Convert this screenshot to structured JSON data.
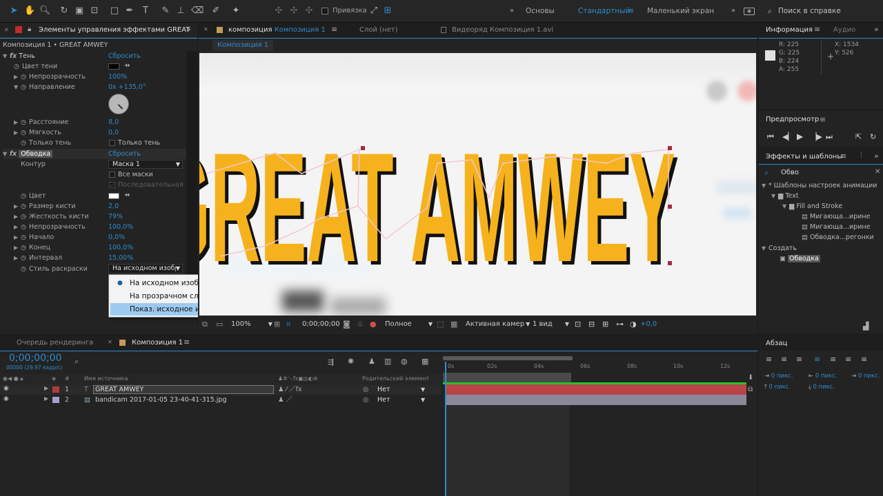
{
  "toolbar": {
    "snapping_label": "Привязка",
    "workspaces": [
      "Основы",
      "Стандартный",
      "Маленький экран"
    ],
    "search_help": "Поиск в справке"
  },
  "effect_controls": {
    "tab_title": "Элементы управления эффектами GREAT",
    "subtitle": "Композиция 1 • GREAT AMWEY",
    "effects": [
      {
        "name": "Тень",
        "reset": "Сбросить",
        "props": [
          {
            "label": "Цвет тени",
            "value": ""
          },
          {
            "label": "Непрозрачность",
            "value": "100%"
          },
          {
            "label": "Направление",
            "value": "0x +135,0°"
          },
          {
            "label": "Расстояние",
            "value": "8,0"
          },
          {
            "label": "Мягкость",
            "value": "0,0"
          },
          {
            "label": "Только тень",
            "value": "Только тень"
          }
        ]
      },
      {
        "name": "Обводка",
        "reset": "Сбросить",
        "props": [
          {
            "label": "Контур",
            "value": "Маска 1"
          },
          {
            "label": "",
            "value": "Все маски"
          },
          {
            "label": "",
            "value": "Последовательная"
          },
          {
            "label": "Цвет",
            "value": ""
          },
          {
            "label": "Размер кисти",
            "value": "2,0"
          },
          {
            "label": "Жесткость кисти",
            "value": "79%"
          },
          {
            "label": "Непрозрачность",
            "value": "100,0%"
          },
          {
            "label": "Начало",
            "value": "0,0%"
          },
          {
            "label": "Конец",
            "value": "100,0%"
          },
          {
            "label": "Интервал",
            "value": "15,00%"
          },
          {
            "label": "Стиль раскраски",
            "value": "На исходном изобр"
          }
        ]
      }
    ],
    "dropdown_options": [
      "На исходном изображении",
      "На прозрачном слое",
      "Показ. исходное изображение"
    ],
    "dropdown_selected_index": 0,
    "dropdown_hover_index": 2
  },
  "composition": {
    "tabs": [
      {
        "prefix": "композиция",
        "name": "Композиция 1"
      },
      {
        "prefix": "",
        "name": "Слой (нет)"
      },
      {
        "prefix": "",
        "name": "Видеоряд Композиция 1.avi"
      }
    ],
    "breadcrumb": "Композиция 1",
    "canvas_text": "GREAT AMWEY",
    "zoom": "100%",
    "timecode": "0;00;00;00",
    "resolution": "Полное",
    "camera": "Активная камер",
    "views": "1 вид",
    "exposure": "+0,0"
  },
  "info": {
    "tab": "Информация",
    "tab2": "Аудио",
    "r": "R: 225",
    "g": "G: 225",
    "b": "B: 224",
    "a": "A: 255",
    "x": "X: 1534",
    "y": "Y: 526"
  },
  "preview": {
    "title": "Предпросмотр"
  },
  "effects_presets": {
    "title": "Эффекты и шаблоны",
    "search": "Обво",
    "tree": [
      {
        "label": "* Шаблоны настроек анимации",
        "level": 0
      },
      {
        "label": "Text",
        "level": 1
      },
      {
        "label": "Fill and Stroke",
        "level": 2
      },
      {
        "label": "Мигающа...ирине",
        "level": 3
      },
      {
        "label": "Мигающа...ирине",
        "level": 3
      },
      {
        "label": "Обводка...регонки",
        "level": 3
      },
      {
        "label": "Создать",
        "level": 0
      },
      {
        "label": "Обводка",
        "level": 1
      }
    ]
  },
  "paragraph": {
    "title": "Абзац",
    "fields": [
      "0 пикс.",
      "0 пикс.",
      "0 пикс.",
      "0 пикс.",
      "0 пикс."
    ]
  },
  "timeline": {
    "render_queue_tab": "Очередь рендеринга",
    "comp_tab": "Композиция 1",
    "timecode": "0;00;00;00",
    "fps": "00000 (29.97 кадр/с)",
    "col_source": "Имя источника",
    "col_parent": "Родительский элемент",
    "ruler": [
      "0s",
      "02s",
      "04s",
      "06s",
      "08s",
      "10s",
      "12s"
    ],
    "layers": [
      {
        "num": "1",
        "name": "GREAT AMWEY",
        "parent": "Нет",
        "color": "#b03a3a"
      },
      {
        "num": "2",
        "name": "bandicam 2017-01-05 23-40-41-315.jpg",
        "parent": "Нет",
        "color": "#a89fd0"
      }
    ]
  }
}
